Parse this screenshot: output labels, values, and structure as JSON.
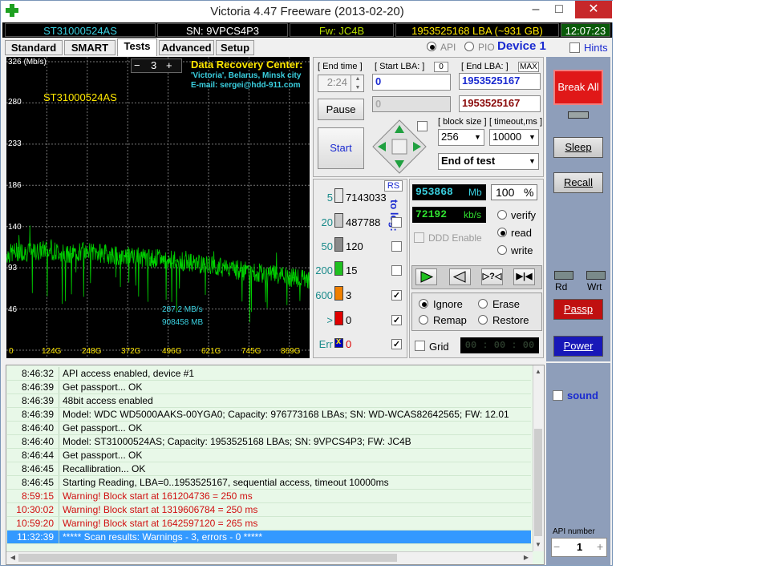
{
  "window": {
    "title": "Victoria 4.47  Freeware (2013-02-20)",
    "buttons": {
      "minimize": "–",
      "maximize": "□",
      "close": "✕"
    },
    "close_color": "#c7282a"
  },
  "infobar": {
    "model": "ST31000524AS",
    "serial": "SN: 9VPCS4P3",
    "firmware": "Fw: JC4B",
    "lba": "1953525168 LBA (~931 GB)",
    "time": "12:07:23"
  },
  "tabs": [
    "Standard",
    "SMART",
    "Tests",
    "Advanced",
    "Setup"
  ],
  "mode": {
    "api": "API",
    "pio": "PIO",
    "device": "Device 1",
    "hints": "Hints"
  },
  "graph": {
    "y_ticks": [
      "326 (Mb/s)",
      "280",
      "233",
      "186",
      "140",
      "93",
      "46",
      "0"
    ],
    "x_ticks": [
      "124G",
      "248G",
      "372G",
      "496G",
      "621G",
      "745G",
      "869G"
    ],
    "drive_label": "ST31000524AS",
    "zoom_minus": "−",
    "zoom_value": "3",
    "zoom_plus": "+",
    "ad_title": "Data Recovery Center:",
    "ad_line1": "'Victoria', Belarus, Minsk city",
    "ad_line2": "E-mail: sergei@hdd-911.com",
    "speed_readout": "287,2 MB/s",
    "mb_readout": "908458 MB"
  },
  "chart_data": {
    "type": "line",
    "title": "",
    "xlabel": "",
    "ylabel": "Mb/s",
    "ylim": [
      0,
      326
    ],
    "xlim_gb": [
      0,
      931
    ],
    "series": [
      {
        "color": "#00d000",
        "x": [
          0,
          40,
          80,
          120,
          160,
          200,
          240,
          280,
          320,
          360,
          400,
          440,
          480,
          520,
          560,
          600,
          640,
          680,
          720,
          760,
          800,
          840,
          880,
          931
        ],
        "values": [
          108,
          112,
          110,
          114,
          111,
          109,
          112,
          110,
          108,
          107,
          106,
          104,
          103,
          101,
          99,
          97,
          95,
          93,
          90,
          88,
          86,
          84,
          82,
          80
        ]
      }
    ],
    "grid": true
  },
  "controls": {
    "end_time_label": "[ End time ]",
    "end_time_value": "2:24",
    "start_lba_label": "[ Start LBA: ]",
    "start_lba_zero": "0",
    "start_lba_value": "0",
    "end_lba_label": "[ End LBA: ]",
    "end_lba_max": "MAX",
    "end_lba_value": "1953525167",
    "start_lba_current": "0",
    "end_lba_current": "1953525167",
    "pause_label": "Pause",
    "start_label": "Start",
    "block_size_label": "[ block size ]",
    "block_size_value": "256",
    "timeout_label": "[ timeout,ms ]",
    "timeout_value": "10000",
    "end_action_value": "End of test"
  },
  "speed_stats": {
    "rs_label": "RS",
    "to_log_label": "to log:",
    "rows": [
      {
        "label": "5",
        "count": "7143033",
        "color": "#e8e8e8",
        "log": false
      },
      {
        "label": "20",
        "count": "487788",
        "color": "#c8c8c8",
        "log": false
      },
      {
        "label": "50",
        "count": "120",
        "color": "#8a8a8a",
        "log": false
      },
      {
        "label": "200",
        "count": "15",
        "color": "#20c020",
        "log": false
      },
      {
        "label": "600",
        "count": "3",
        "color": "#f08000",
        "log": true
      },
      {
        "label": ">",
        "count": "0",
        "color": "#e00000",
        "log": true
      },
      {
        "label": "Err",
        "count": "0",
        "color": "#0000c0",
        "log": true
      }
    ],
    "err_mark": "x"
  },
  "progress": {
    "mb_value": "953868",
    "mb_unit": "Mb",
    "percent_value": "100",
    "percent_unit": "%",
    "kbs_value": "72192",
    "kbs_unit": "kb/s",
    "ddd_label": "DDD Enable",
    "verify_label": "verify",
    "read_label": "read",
    "write_label": "write"
  },
  "actions": {
    "ignore_label": "Ignore",
    "erase_label": "Erase",
    "remap_label": "Remap",
    "restore_label": "Restore",
    "grid_label": "Grid",
    "grid_timer": "00 : 00 : 00"
  },
  "sidebar": {
    "break_all": "Break All",
    "sleep": "Sleep",
    "recall": "Recall",
    "rd": "Rd",
    "wrt": "Wrt",
    "passp": "Passp",
    "power": "Power",
    "sound": "sound",
    "api_number_label": "API number",
    "api_number_value": "1",
    "api_minus": "−",
    "api_plus": "+"
  },
  "log": [
    {
      "time": "8:46:32",
      "msg": "API access enabled, device #1",
      "type": "normal"
    },
    {
      "time": "8:46:39",
      "msg": "Get passport... OK",
      "type": "normal"
    },
    {
      "time": "8:46:39",
      "msg": "48bit access enabled",
      "type": "normal"
    },
    {
      "time": "8:46:39",
      "msg": "Model: WDC WD5000AAKS-00YGA0; Capacity: 976773168 LBAs; SN: WD-WCAS82642565; FW: 12.01",
      "type": "normal"
    },
    {
      "time": "8:46:40",
      "msg": "Get passport... OK",
      "type": "normal"
    },
    {
      "time": "8:46:40",
      "msg": "Model: ST31000524AS; Capacity: 1953525168 LBAs; SN: 9VPCS4P3; FW: JC4B",
      "type": "normal"
    },
    {
      "time": "8:46:44",
      "msg": "Get passport... OK",
      "type": "normal"
    },
    {
      "time": "8:46:45",
      "msg": "Recallibration... OK",
      "type": "normal"
    },
    {
      "time": "8:46:45",
      "msg": "Starting Reading, LBA=0..1953525167, sequential access, timeout 10000ms",
      "type": "normal"
    },
    {
      "time": "8:59:15",
      "msg": "Warning! Block start at 161204736 = 250 ms",
      "type": "warning"
    },
    {
      "time": "10:30:02",
      "msg": "Warning! Block start at 1319606784 = 250 ms",
      "type": "warning"
    },
    {
      "time": "10:59:20",
      "msg": "Warning! Block start at 1642597120 = 265 ms",
      "type": "warning"
    },
    {
      "time": "11:32:39",
      "msg": "***** Scan results: Warnings - 3, errors - 0 *****",
      "type": "selected"
    }
  ]
}
